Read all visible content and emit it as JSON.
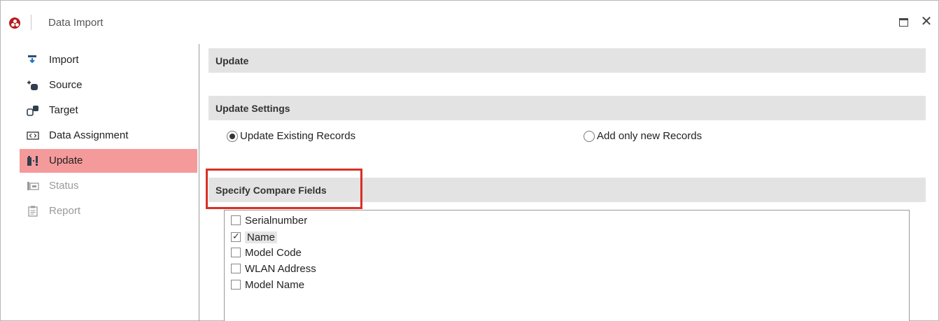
{
  "window": {
    "title": "Data Import"
  },
  "sidebar": {
    "items": [
      {
        "label": "Import",
        "icon": "import-icon",
        "state": "normal"
      },
      {
        "label": "Source",
        "icon": "source-icon",
        "state": "normal"
      },
      {
        "label": "Target",
        "icon": "target-icon",
        "state": "normal"
      },
      {
        "label": "Data Assignment",
        "icon": "data-assignment-icon",
        "state": "normal"
      },
      {
        "label": "Update",
        "icon": "update-icon",
        "state": "active"
      },
      {
        "label": "Status",
        "icon": "status-icon",
        "state": "disabled"
      },
      {
        "label": "Report",
        "icon": "report-icon",
        "state": "disabled"
      }
    ]
  },
  "main": {
    "update_header": "Update",
    "settings_header": "Update Settings",
    "radio_update_existing": "Update Existing Records",
    "radio_add_new": "Add only new Records",
    "selected_radio": "Update Existing Records",
    "compare_header": "Specify Compare Fields",
    "compare_fields": [
      {
        "label": "Serialnumber",
        "checked": false
      },
      {
        "label": "Name",
        "checked": true
      },
      {
        "label": "Model Code",
        "checked": false
      },
      {
        "label": "WLAN Address",
        "checked": false
      },
      {
        "label": "Model Name",
        "checked": false
      }
    ]
  },
  "colors": {
    "active_item": "#f59a9a",
    "highlight": "#d93025",
    "section_header": "#e3e3e3"
  }
}
